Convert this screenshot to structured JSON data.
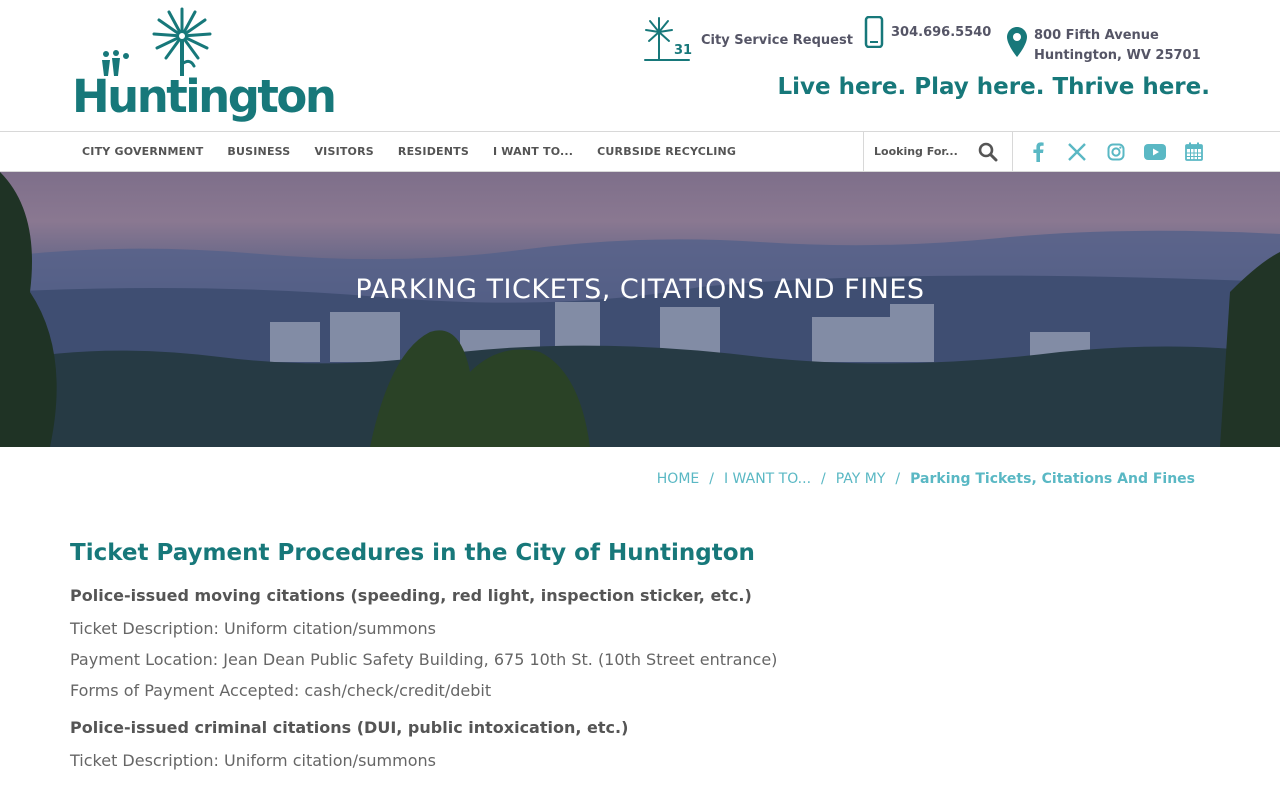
{
  "logo": {
    "text": "Huntington"
  },
  "header": {
    "service": {
      "icon": "city-311-icon",
      "badge": "311",
      "label": "City Service Request"
    },
    "phone": {
      "icon": "phone-icon",
      "number": "304.696.5540"
    },
    "address": {
      "icon": "location-pin-icon",
      "line1": "800 Fifth Avenue",
      "line2": "Huntington, WV 25701"
    },
    "tagline": "Live here. Play here. Thrive here."
  },
  "nav": {
    "items": [
      "CITY GOVERNMENT",
      "BUSINESS",
      "VISITORS",
      "RESIDENTS",
      "I WANT TO...",
      "CURBSIDE RECYCLING"
    ],
    "search_placeholder": "Looking For..."
  },
  "social": [
    "facebook-icon",
    "x-icon",
    "instagram-icon",
    "youtube-icon",
    "calendar-icon"
  ],
  "hero": {
    "title": "PARKING TICKETS, CITATIONS AND FINES"
  },
  "breadcrumb": [
    "HOME",
    "I WANT TO...",
    "PAY MY",
    "Parking Tickets, Citations And Fines"
  ],
  "content": {
    "heading": "Ticket Payment Procedures in the City of Huntington",
    "sections": [
      {
        "title": "Police-issued moving citations (speeding, red light, inspection sticker, etc.)",
        "lines": [
          "Ticket Description: Uniform citation/summons",
          "Payment Location: Jean Dean Public Safety Building, 675 10th St. (10th Street entrance)",
          "Forms of Payment Accepted: cash/check/credit/debit"
        ]
      },
      {
        "title": "Police-issued criminal citations (DUI, public intoxication, etc.)",
        "lines": [
          "Ticket Description: Uniform citation/summons"
        ]
      }
    ]
  },
  "colors": {
    "brand": "#17787a",
    "link": "#5ab8c4",
    "text": "#555555"
  }
}
